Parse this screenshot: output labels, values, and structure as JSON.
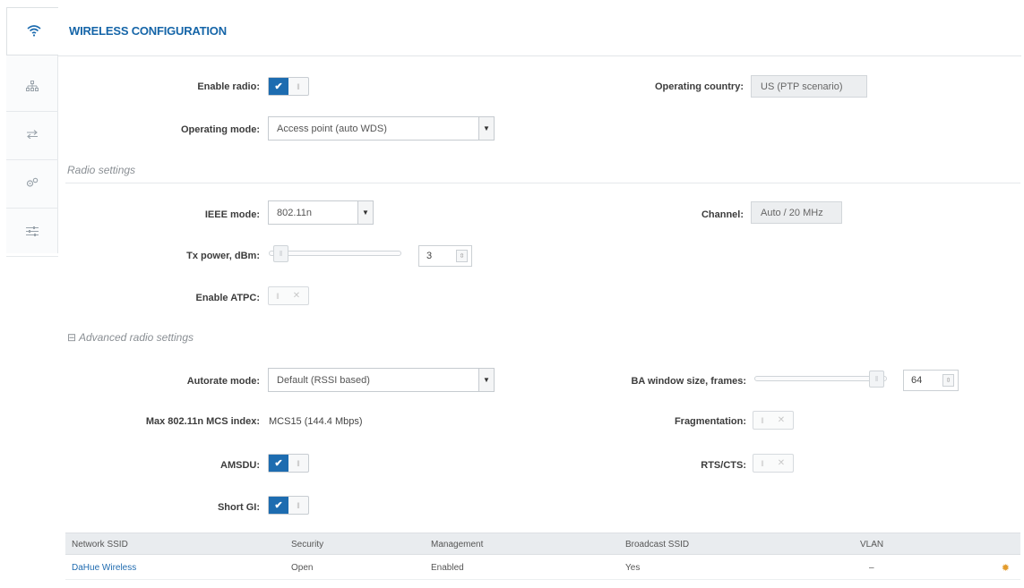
{
  "sidebar": {
    "items": [
      {
        "icon": "wifi-icon"
      },
      {
        "icon": "network-icon"
      },
      {
        "icon": "transfer-icon"
      },
      {
        "icon": "gears-icon"
      },
      {
        "icon": "sliders-icon"
      }
    ]
  },
  "header": {
    "title": "WIRELESS CONFIGURATION"
  },
  "general": {
    "enable_radio_label": "Enable radio:",
    "enable_radio_value": true,
    "operating_country_label": "Operating country:",
    "operating_country_value": "US (PTP scenario)",
    "operating_mode_label": "Operating mode:",
    "operating_mode_value": "Access point (auto WDS)"
  },
  "radio": {
    "section_title": "Radio settings",
    "ieee_mode_label": "IEEE mode:",
    "ieee_mode_value": "802.11n",
    "channel_label": "Channel:",
    "channel_value": "Auto / 20 MHz",
    "tx_power_label": "Tx power, dBm:",
    "tx_power_value": "3",
    "enable_atpc_label": "Enable ATPC:",
    "enable_atpc_value": false
  },
  "advanced": {
    "section_title": "Advanced radio settings",
    "collapse_symbol": "⊟",
    "autorate_label": "Autorate mode:",
    "autorate_value": "Default (RSSI based)",
    "ba_window_label": "BA window size, frames:",
    "ba_window_value": "64",
    "max_mcs_label": "Max 802.11n MCS index:",
    "max_mcs_value": "MCS15 (144.4 Mbps)",
    "fragmentation_label": "Fragmentation:",
    "fragmentation_value": false,
    "amsdu_label": "AMSDU:",
    "amsdu_value": true,
    "rts_cts_label": "RTS/CTS:",
    "rts_cts_value": false,
    "short_gi_label": "Short GI:",
    "short_gi_value": true
  },
  "ssid_table": {
    "columns": [
      "Network SSID",
      "Security",
      "Management",
      "Broadcast SSID",
      "VLAN"
    ],
    "rows": [
      {
        "ssid": "DaHue Wireless",
        "security": "Open",
        "management": "Enabled",
        "broadcast": "Yes",
        "vlan": "–"
      }
    ]
  },
  "colors": {
    "accent": "#1d6cb0",
    "title": "#1565a8",
    "gear": "#e39b2b"
  }
}
